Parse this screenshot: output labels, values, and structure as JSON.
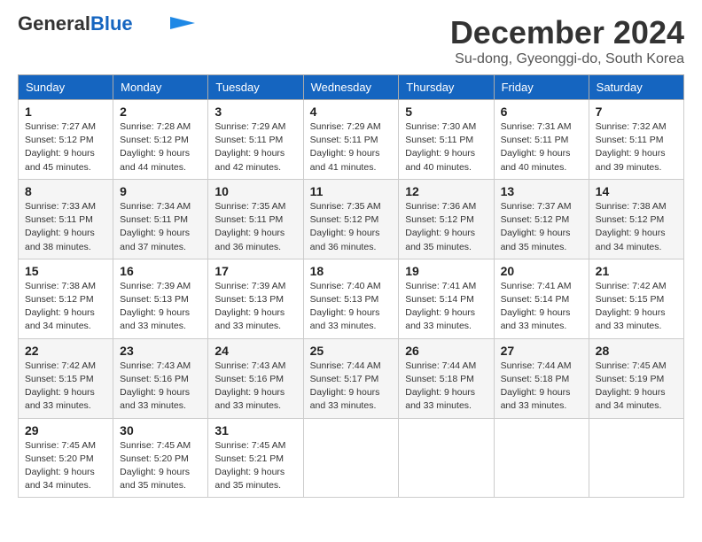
{
  "logo": {
    "general": "General",
    "blue": "Blue",
    "tagline": ""
  },
  "header": {
    "month": "December 2024",
    "location": "Su-dong, Gyeonggi-do, South Korea"
  },
  "weekdays": [
    "Sunday",
    "Monday",
    "Tuesday",
    "Wednesday",
    "Thursday",
    "Friday",
    "Saturday"
  ],
  "weeks": [
    [
      {
        "day": "1",
        "sunrise": "Sunrise: 7:27 AM",
        "sunset": "Sunset: 5:12 PM",
        "daylight": "Daylight: 9 hours and 45 minutes."
      },
      {
        "day": "2",
        "sunrise": "Sunrise: 7:28 AM",
        "sunset": "Sunset: 5:12 PM",
        "daylight": "Daylight: 9 hours and 44 minutes."
      },
      {
        "day": "3",
        "sunrise": "Sunrise: 7:29 AM",
        "sunset": "Sunset: 5:11 PM",
        "daylight": "Daylight: 9 hours and 42 minutes."
      },
      {
        "day": "4",
        "sunrise": "Sunrise: 7:29 AM",
        "sunset": "Sunset: 5:11 PM",
        "daylight": "Daylight: 9 hours and 41 minutes."
      },
      {
        "day": "5",
        "sunrise": "Sunrise: 7:30 AM",
        "sunset": "Sunset: 5:11 PM",
        "daylight": "Daylight: 9 hours and 40 minutes."
      },
      {
        "day": "6",
        "sunrise": "Sunrise: 7:31 AM",
        "sunset": "Sunset: 5:11 PM",
        "daylight": "Daylight: 9 hours and 40 minutes."
      },
      {
        "day": "7",
        "sunrise": "Sunrise: 7:32 AM",
        "sunset": "Sunset: 5:11 PM",
        "daylight": "Daylight: 9 hours and 39 minutes."
      }
    ],
    [
      {
        "day": "8",
        "sunrise": "Sunrise: 7:33 AM",
        "sunset": "Sunset: 5:11 PM",
        "daylight": "Daylight: 9 hours and 38 minutes."
      },
      {
        "day": "9",
        "sunrise": "Sunrise: 7:34 AM",
        "sunset": "Sunset: 5:11 PM",
        "daylight": "Daylight: 9 hours and 37 minutes."
      },
      {
        "day": "10",
        "sunrise": "Sunrise: 7:35 AM",
        "sunset": "Sunset: 5:11 PM",
        "daylight": "Daylight: 9 hours and 36 minutes."
      },
      {
        "day": "11",
        "sunrise": "Sunrise: 7:35 AM",
        "sunset": "Sunset: 5:12 PM",
        "daylight": "Daylight: 9 hours and 36 minutes."
      },
      {
        "day": "12",
        "sunrise": "Sunrise: 7:36 AM",
        "sunset": "Sunset: 5:12 PM",
        "daylight": "Daylight: 9 hours and 35 minutes."
      },
      {
        "day": "13",
        "sunrise": "Sunrise: 7:37 AM",
        "sunset": "Sunset: 5:12 PM",
        "daylight": "Daylight: 9 hours and 35 minutes."
      },
      {
        "day": "14",
        "sunrise": "Sunrise: 7:38 AM",
        "sunset": "Sunset: 5:12 PM",
        "daylight": "Daylight: 9 hours and 34 minutes."
      }
    ],
    [
      {
        "day": "15",
        "sunrise": "Sunrise: 7:38 AM",
        "sunset": "Sunset: 5:12 PM",
        "daylight": "Daylight: 9 hours and 34 minutes."
      },
      {
        "day": "16",
        "sunrise": "Sunrise: 7:39 AM",
        "sunset": "Sunset: 5:13 PM",
        "daylight": "Daylight: 9 hours and 33 minutes."
      },
      {
        "day": "17",
        "sunrise": "Sunrise: 7:39 AM",
        "sunset": "Sunset: 5:13 PM",
        "daylight": "Daylight: 9 hours and 33 minutes."
      },
      {
        "day": "18",
        "sunrise": "Sunrise: 7:40 AM",
        "sunset": "Sunset: 5:13 PM",
        "daylight": "Daylight: 9 hours and 33 minutes."
      },
      {
        "day": "19",
        "sunrise": "Sunrise: 7:41 AM",
        "sunset": "Sunset: 5:14 PM",
        "daylight": "Daylight: 9 hours and 33 minutes."
      },
      {
        "day": "20",
        "sunrise": "Sunrise: 7:41 AM",
        "sunset": "Sunset: 5:14 PM",
        "daylight": "Daylight: 9 hours and 33 minutes."
      },
      {
        "day": "21",
        "sunrise": "Sunrise: 7:42 AM",
        "sunset": "Sunset: 5:15 PM",
        "daylight": "Daylight: 9 hours and 33 minutes."
      }
    ],
    [
      {
        "day": "22",
        "sunrise": "Sunrise: 7:42 AM",
        "sunset": "Sunset: 5:15 PM",
        "daylight": "Daylight: 9 hours and 33 minutes."
      },
      {
        "day": "23",
        "sunrise": "Sunrise: 7:43 AM",
        "sunset": "Sunset: 5:16 PM",
        "daylight": "Daylight: 9 hours and 33 minutes."
      },
      {
        "day": "24",
        "sunrise": "Sunrise: 7:43 AM",
        "sunset": "Sunset: 5:16 PM",
        "daylight": "Daylight: 9 hours and 33 minutes."
      },
      {
        "day": "25",
        "sunrise": "Sunrise: 7:44 AM",
        "sunset": "Sunset: 5:17 PM",
        "daylight": "Daylight: 9 hours and 33 minutes."
      },
      {
        "day": "26",
        "sunrise": "Sunrise: 7:44 AM",
        "sunset": "Sunset: 5:18 PM",
        "daylight": "Daylight: 9 hours and 33 minutes."
      },
      {
        "day": "27",
        "sunrise": "Sunrise: 7:44 AM",
        "sunset": "Sunset: 5:18 PM",
        "daylight": "Daylight: 9 hours and 33 minutes."
      },
      {
        "day": "28",
        "sunrise": "Sunrise: 7:45 AM",
        "sunset": "Sunset: 5:19 PM",
        "daylight": "Daylight: 9 hours and 34 minutes."
      }
    ],
    [
      {
        "day": "29",
        "sunrise": "Sunrise: 7:45 AM",
        "sunset": "Sunset: 5:20 PM",
        "daylight": "Daylight: 9 hours and 34 minutes."
      },
      {
        "day": "30",
        "sunrise": "Sunrise: 7:45 AM",
        "sunset": "Sunset: 5:20 PM",
        "daylight": "Daylight: 9 hours and 35 minutes."
      },
      {
        "day": "31",
        "sunrise": "Sunrise: 7:45 AM",
        "sunset": "Sunset: 5:21 PM",
        "daylight": "Daylight: 9 hours and 35 minutes."
      },
      null,
      null,
      null,
      null
    ]
  ]
}
